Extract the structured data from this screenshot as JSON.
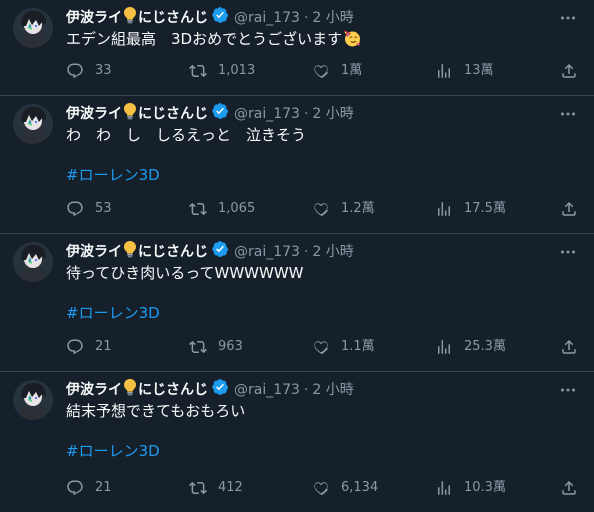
{
  "tweets": [
    {
      "name": "伊波ライ",
      "name_suffix": "にじさんじ",
      "handle": "@rai_173",
      "dot": "·",
      "time": "2 小時",
      "text": "エデン組最高　3Dおめでとうございます",
      "emoji": "partying-face-emoji",
      "hashtag": "",
      "replies": "33",
      "retweets": "1,013",
      "likes": "1萬",
      "views": "13萬"
    },
    {
      "name": "伊波ライ",
      "name_suffix": "にじさんじ",
      "handle": "@rai_173",
      "dot": "·",
      "time": "2 小時",
      "text": "わ　わ　し　しるえっと　泣きそう",
      "hashtag": "#ローレン3D",
      "replies": "53",
      "retweets": "1,065",
      "likes": "1.2萬",
      "views": "17.5萬"
    },
    {
      "name": "伊波ライ",
      "name_suffix": "にじさんじ",
      "handle": "@rai_173",
      "dot": "·",
      "time": "2 小時",
      "text": "待ってひき肉いるってWWWWWW",
      "hashtag": "#ローレン3D",
      "replies": "21",
      "retweets": "963",
      "likes": "1.1萬",
      "views": "25.3萬"
    },
    {
      "name": "伊波ライ",
      "name_suffix": "にじさんじ",
      "handle": "@rai_173",
      "dot": "·",
      "time": "2 小時",
      "text": "結末予想できてもおもろい",
      "hashtag": "#ローレン3D",
      "replies": "21",
      "retweets": "412",
      "likes": "6,134",
      "views": "10.3萬"
    }
  ],
  "colors": {
    "background": "#15202b",
    "text": "#f7f9f9",
    "muted": "#8b98a5",
    "link": "#1d9bf0",
    "divider": "#38444d",
    "verified": "#1d9bf0"
  }
}
